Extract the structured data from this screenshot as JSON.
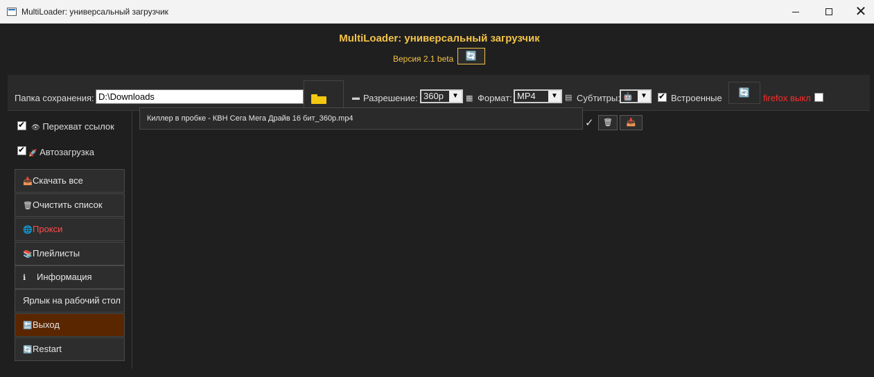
{
  "window": {
    "title": "MultiLoader: универсальный загрузчик",
    "minimize": "—",
    "close": "✕"
  },
  "header": {
    "title": "MultiLoader: универсальный загрузчик",
    "version": "Версия 2.1 beta",
    "refresh_icon": "🔄"
  },
  "toolbar": {
    "folder_label": "Папка сохранения:",
    "folder_value": "D:\\Downloads",
    "resolution_label": "Разрешение:",
    "resolution_value": "360p",
    "format_label": "Формат:",
    "format_value": "MP4",
    "subtitles_label": "Субтитры:",
    "subtitles_value": "🤖",
    "embedded_label": "Встроенные",
    "embedded_checked": true,
    "refresh_icon": "🔄",
    "firefox_label": "firefox выкл",
    "firefox_checked": false,
    "icons": {
      "resolution": "monitor-icon",
      "format": "clapper-icon",
      "subtitles": "notepad-icon"
    }
  },
  "sidebar": {
    "checks": [
      {
        "label": "Перехват ссылок",
        "icon": "👁",
        "checked": true
      },
      {
        "label": "Автозагрузка",
        "icon": "🚀",
        "checked": true
      }
    ],
    "buttons": [
      {
        "label": "Скачать все",
        "icon": "📥"
      },
      {
        "label": "Очистить список",
        "icon": "🗑"
      },
      {
        "label": "Прокси",
        "icon": "🌐"
      },
      {
        "label": "Плейлисты",
        "icon": "📚"
      },
      {
        "label": "Информация",
        "icon": "ℹ"
      },
      {
        "label": "Ярлык на рабочий стол",
        "icon": ""
      },
      {
        "label": "Выход",
        "icon": "🔚"
      },
      {
        "label": "Restart",
        "icon": "🔄"
      }
    ]
  },
  "downloads": [
    {
      "filename": "Киллер в пробке - КВН Сега Мега Драйв 16 бит_360p.mp4",
      "done": true,
      "delete_icon": "🗑",
      "save_icon": "📥"
    }
  ],
  "colors": {
    "accent": "#f4c34a",
    "danger": "#ff4d4d",
    "exit_bg": "#5a2600"
  }
}
